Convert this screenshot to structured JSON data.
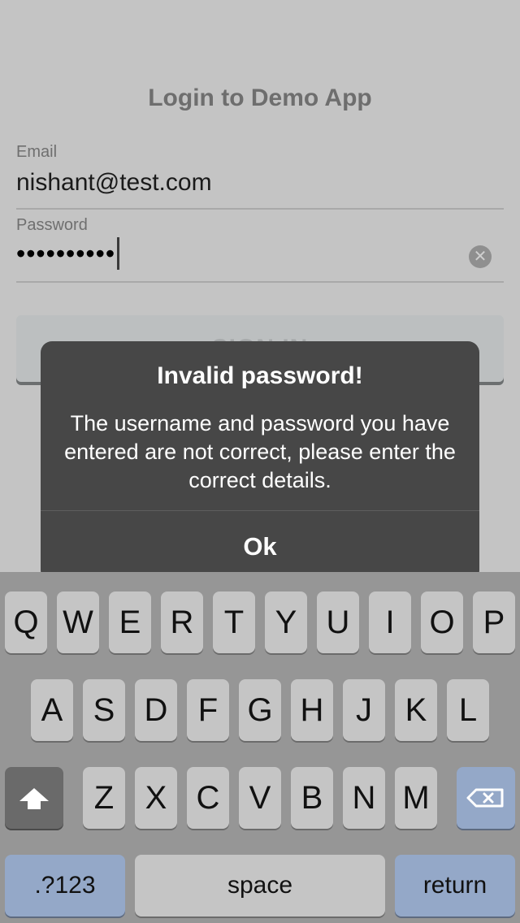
{
  "header": {
    "title": "Login to Demo App"
  },
  "form": {
    "email_label": "Email",
    "email_value": "nishant@test.com",
    "password_label": "Password",
    "password_value": "••••••••••",
    "signin_label": "SIGN IN"
  },
  "alert": {
    "title": "Invalid password!",
    "message": "The username and password you have entered are not correct, please enter the correct details.",
    "ok_label": "Ok"
  },
  "keyboard": {
    "row1": [
      "Q",
      "W",
      "E",
      "R",
      "T",
      "Y",
      "U",
      "I",
      "O",
      "P"
    ],
    "row2": [
      "A",
      "S",
      "D",
      "F",
      "G",
      "H",
      "J",
      "K",
      "L"
    ],
    "row3": [
      "Z",
      "X",
      "C",
      "V",
      "B",
      "N",
      "M"
    ],
    "numbers_label": ".?123",
    "space_label": "space",
    "return_label": "return",
    "shift_icon": "shift-arrow-icon",
    "delete_icon": "backspace-icon"
  },
  "colors": {
    "background": "#c4c4c4",
    "alert_bg": "#474747",
    "keyboard_bg": "#969696",
    "special_key": "#94a8c8"
  }
}
